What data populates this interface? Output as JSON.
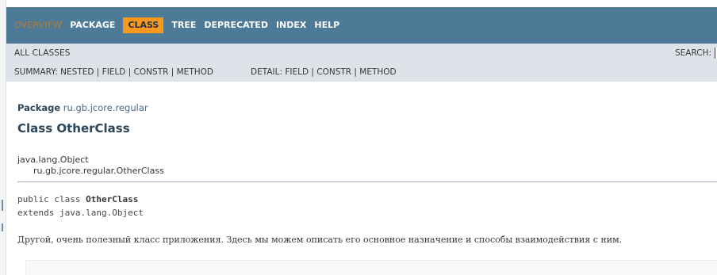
{
  "nav": {
    "items": [
      {
        "label": "OVERVIEW",
        "state": "disabled"
      },
      {
        "label": "PACKAGE",
        "state": "normal"
      },
      {
        "label": "CLASS",
        "state": "active"
      },
      {
        "label": "TREE",
        "state": "normal"
      },
      {
        "label": "DEPRECATED",
        "state": "normal"
      },
      {
        "label": "INDEX",
        "state": "normal"
      },
      {
        "label": "HELP",
        "state": "normal"
      }
    ]
  },
  "subnav": {
    "all_classes": "ALL CLASSES",
    "search_label": "SEARCH:",
    "summary": "SUMMARY: NESTED | FIELD | CONSTR | METHOD",
    "detail": "DETAIL: FIELD | CONSTR | METHOD"
  },
  "header": {
    "package_label": "Package",
    "package_name": "ru.gb.jcore.regular",
    "title": "Class OtherClass"
  },
  "inheritance": {
    "parent": "java.lang.Object",
    "child": "ru.gb.jcore.regular.OtherClass"
  },
  "signature": {
    "line1_prefix": "public class ",
    "line1_name": "OtherClass",
    "line2": "extends java.lang.Object"
  },
  "description": "Другой, очень полезный класс приложения. Здесь мы можем описать его основное назначение и способы взаимодействия с ним.",
  "colors": {
    "nav_bg": "#4d7a97",
    "subnav_bg": "#dee3e9",
    "active_tab": "#f8981d",
    "title_color": "#2c4557"
  }
}
